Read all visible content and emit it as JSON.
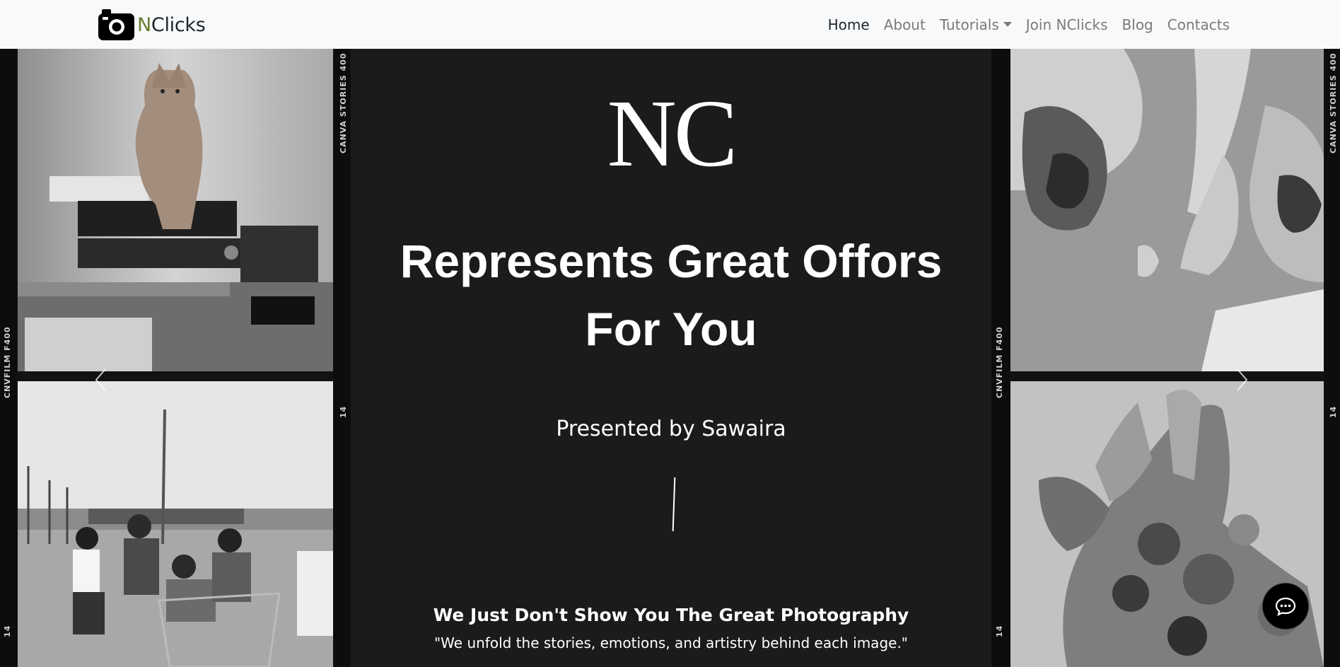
{
  "brand": {
    "logo_icon": "camera-icon",
    "prefix": "N",
    "name": "Clicks"
  },
  "nav": {
    "items": [
      {
        "label": "Home",
        "active": true
      },
      {
        "label": "About"
      },
      {
        "label": "Tutorials",
        "dropdown": true
      },
      {
        "label": "Join NClicks"
      },
      {
        "label": "Blog"
      },
      {
        "label": "Contacts"
      }
    ]
  },
  "hero": {
    "monogram": "NC",
    "headline_line1": "Represents Great Offors",
    "headline_line2": "For You",
    "presented_by": "Presented by Sawaira",
    "tagline": "We Just Don't Show You The Great Photography",
    "quote": "\"We unfold the stories, emotions, and artistry behind each image.\""
  },
  "film": {
    "label_a": "CANVA STORIES 400",
    "label_b": "CNVFILM F400",
    "frame_number": "14"
  },
  "carousel": {
    "prev_icon": "chevron-left-icon",
    "next_icon": "chevron-right-icon"
  },
  "chat": {
    "icon": "chat-bubble-icon"
  },
  "colors": {
    "navbar_bg": "#f8f9fa",
    "hero_bg": "#1b1b1b",
    "text_light": "#ffffff",
    "nav_inactive": "#7a7a7a"
  }
}
